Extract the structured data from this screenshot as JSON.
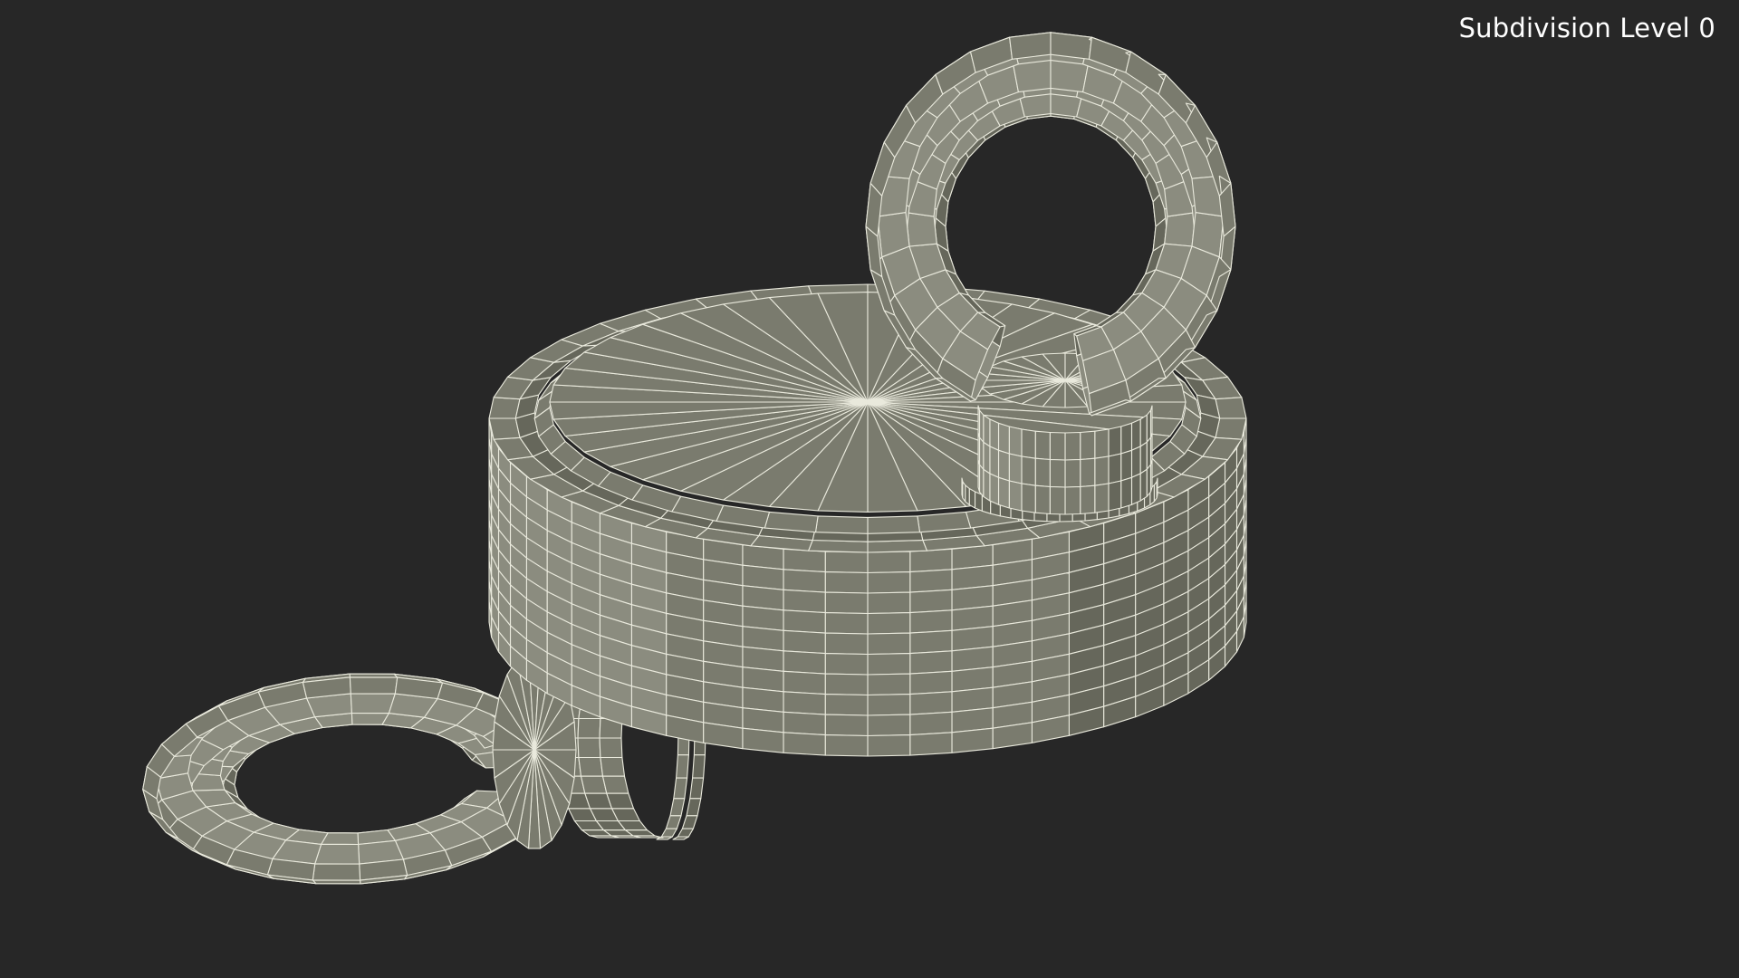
{
  "viewport": {
    "label": "Subdivision Level 0",
    "background_color": "#272727",
    "label_color": "#ffffff",
    "mesh_fill_color": "#7a7b6e",
    "mesh_shade_color": "#66675b",
    "mesh_highlight_color": "#8b8c7f",
    "wire_color": "#e9e9dc"
  },
  "scene": {
    "objects": [
      {
        "name": "magnet-body",
        "icon": "cylinder-mesh"
      },
      {
        "name": "top-eye-bolt",
        "icon": "torus-mesh"
      },
      {
        "name": "side-eye-bolt",
        "icon": "torus-mesh"
      }
    ]
  }
}
